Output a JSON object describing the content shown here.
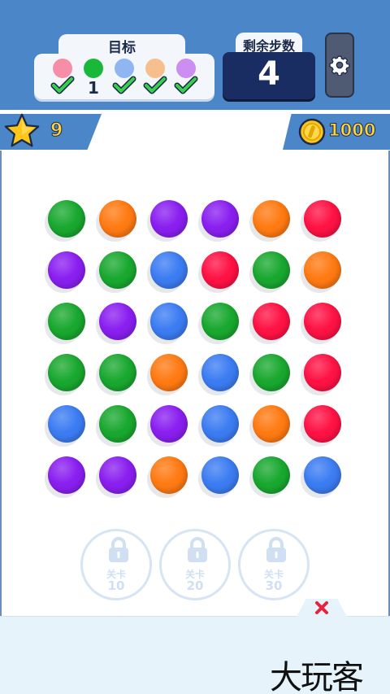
{
  "header": {
    "goal_title": "目标",
    "goals": [
      {
        "color": "#f58ea6",
        "done": true,
        "count": ""
      },
      {
        "color": "#19b83a",
        "done": false,
        "count": "1"
      },
      {
        "color": "#8fb6f0",
        "done": true,
        "count": ""
      },
      {
        "color": "#f7be8e",
        "done": true,
        "count": ""
      },
      {
        "color": "#cc8ef0",
        "done": true,
        "count": ""
      }
    ],
    "moves_label": "剩余步数",
    "moves_value": "4"
  },
  "stats": {
    "stars": "9",
    "coins": "1000"
  },
  "board": {
    "rows": [
      [
        "green",
        "orange",
        "purple",
        "purple",
        "orange",
        "red"
      ],
      [
        "purple",
        "green",
        "blue",
        "red",
        "green",
        "orange"
      ],
      [
        "green",
        "purple",
        "blue",
        "green",
        "red",
        "red"
      ],
      [
        "green",
        "green",
        "orange",
        "blue",
        "green",
        "red"
      ],
      [
        "blue",
        "green",
        "purple",
        "blue",
        "orange",
        "red"
      ],
      [
        "purple",
        "purple",
        "orange",
        "blue",
        "green",
        "blue"
      ]
    ],
    "colors": {
      "green": "#19a82f",
      "orange": "#ff7a12",
      "purple": "#8a1ff0",
      "red": "#ff1244",
      "blue": "#3c7cf2"
    }
  },
  "locked_levels": [
    {
      "label": "关卡",
      "level": "10"
    },
    {
      "label": "关卡",
      "level": "20"
    },
    {
      "label": "关卡",
      "level": "30"
    }
  ],
  "watermark": "大玩客"
}
